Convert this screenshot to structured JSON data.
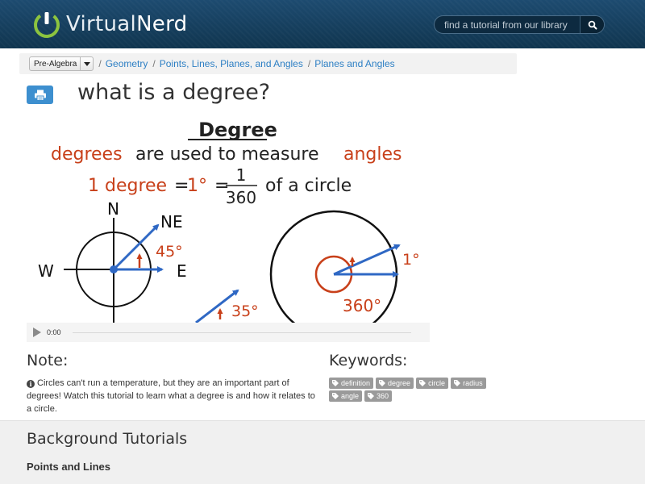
{
  "header": {
    "logo_light": "Virtual",
    "logo_bold": "Nerd",
    "search_placeholder": "find a tutorial from our library"
  },
  "breadcrumb": {
    "subject": "Pre-Algebra",
    "items": [
      "Geometry",
      "Points, Lines, Planes, and Angles",
      "Planes and Angles"
    ]
  },
  "page_title": "what is a degree?",
  "video": {
    "heading": "Degree",
    "line1": {
      "a": "degrees",
      "b": "are used to measure",
      "c": "angles"
    },
    "formula": {
      "left": "1 degree",
      "eq1": "=",
      "mid": "1°",
      "eq2": "=",
      "num": "1",
      "den": "360",
      "right": "of a circle"
    },
    "compass": {
      "n": "N",
      "ne": "NE",
      "w": "W",
      "e": "E",
      "angle": "45°",
      "angle2": "35°"
    },
    "circle": {
      "small": "1°",
      "full": "360°"
    },
    "time": "0:00"
  },
  "note": {
    "heading": "Note:",
    "text": "Circles can't run a temperature, but they are an important part of degrees! Watch this tutorial to learn what a degree is and how it relates to a circle."
  },
  "keywords": {
    "heading": "Keywords:",
    "tags": [
      "definition",
      "degree",
      "circle",
      "radius",
      "angle",
      "360"
    ]
  },
  "background": {
    "heading": "Background Tutorials",
    "items": [
      "Points and Lines"
    ]
  },
  "colors": {
    "header_bg": "#16405f",
    "link": "#2d7fc4",
    "accent_blue": "#3d8fcf",
    "diagram_red": "#c8401a",
    "diagram_blue": "#2f68c4",
    "tag_bg": "#9a9a9a"
  }
}
